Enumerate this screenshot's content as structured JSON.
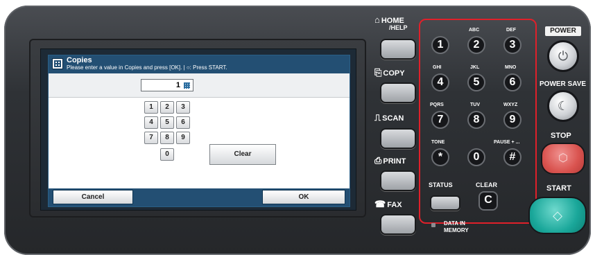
{
  "lcd": {
    "title": "Copies",
    "instruction": "Please enter a value in Copies and press [OK]. | ○: Press START.",
    "value": "1",
    "keys": [
      "1",
      "2",
      "3",
      "4",
      "5",
      "6",
      "7",
      "8",
      "9",
      "0"
    ],
    "clear_label": "Clear",
    "cancel_label": "Cancel",
    "ok_label": "OK"
  },
  "modes": {
    "home": "HOME",
    "help": "/HELP",
    "copy": "COPY",
    "scan": "SCAN",
    "print": "PRINT",
    "fax": "FAX"
  },
  "keypad": {
    "digits": [
      "1",
      "2",
      "3",
      "4",
      "5",
      "6",
      "7",
      "8",
      "9",
      "*",
      "0",
      "#"
    ],
    "letters": {
      "abc": "ABC",
      "def": "DEF",
      "ghi": "GHI",
      "jkl": "JKL",
      "mno": "MNO",
      "pqrs": "PQRS",
      "tuv": "TUV",
      "wxyz": "WXYZ",
      "tone": "TONE",
      "pause": "PAUSE + ..."
    },
    "clear_label": "CLEAR",
    "clear_key": "C"
  },
  "right": {
    "power": "POWER",
    "power_save": "POWER SAVE",
    "stop": "STOP",
    "start": "START",
    "status": "STATUS",
    "data_in_memory_1": "DATA IN",
    "data_in_memory_2": "MEMORY"
  },
  "colors": {
    "screen_header": "#234f73",
    "highlight": "#e0202a",
    "stop": "#d9534f",
    "start": "#1aa79a"
  }
}
